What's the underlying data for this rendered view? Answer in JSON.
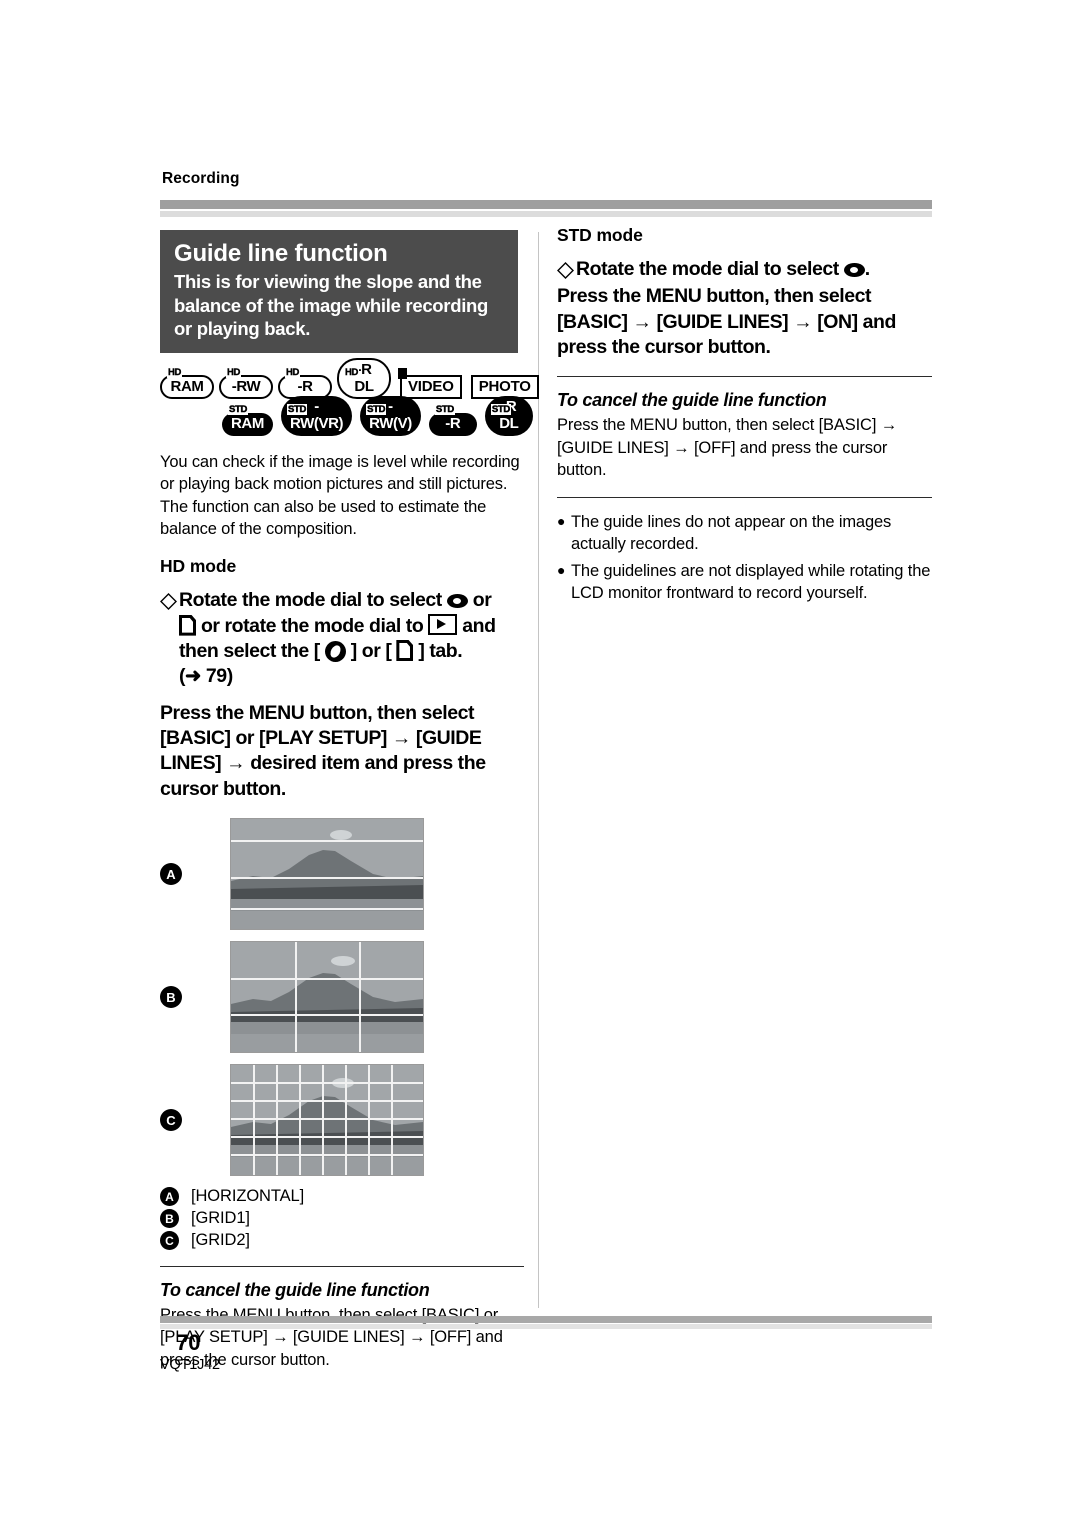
{
  "header": {
    "section_label": "Recording"
  },
  "title_box": {
    "heading": "Guide line function",
    "description": "This is for viewing the slope and the balance of the image while recording or playing back."
  },
  "media_badges": {
    "row1": [
      {
        "tag": "HD",
        "label": "RAM",
        "style": "outline-pill"
      },
      {
        "tag": "HD",
        "label": "-RW",
        "style": "outline-pill"
      },
      {
        "tag": "HD",
        "label": "-R",
        "style": "outline-pill"
      },
      {
        "tag": "HD",
        "label": "-R DL",
        "style": "outline-pill"
      },
      {
        "tag": "",
        "label": "VIDEO",
        "style": "rect-corner"
      },
      {
        "tag": "",
        "label": "PHOTO",
        "style": "rect"
      }
    ],
    "row2": [
      {
        "tag": "STD",
        "label": "RAM",
        "style": "filled-pill"
      },
      {
        "tag": "STD",
        "label": "-RW(VR)",
        "style": "filled-pill"
      },
      {
        "tag": "STD",
        "label": "-RW(V)",
        "style": "filled-pill"
      },
      {
        "tag": "STD",
        "label": "-R",
        "style": "filled-pill"
      },
      {
        "tag": "STD",
        "label": "-R DL",
        "style": "filled-pill"
      }
    ]
  },
  "left": {
    "intro": "You can check if the image is level while recording or playing back motion pictures and still pictures. The function can also be used to estimate the balance of the composition.",
    "hd_mode_heading": "HD mode",
    "hd_step1": {
      "part1": "Rotate the mode dial to select",
      "icon1": "video-mode-icon",
      "part2": "or",
      "icon2": "photo-mode-icon",
      "part3": "or rotate the mode dial to",
      "icon3": "playback-mode-icon",
      "part4": "and then select the [",
      "icon4": "video-tab-icon",
      "part5": "] or [",
      "icon5": "photo-tab-icon",
      "part6": "] tab.",
      "reference": "(➜ 79)"
    },
    "hd_step2": "Press the MENU button, then select [BASIC] or [PLAY SETUP] → [GUIDE LINES] → desired item and press the cursor button.",
    "samples": [
      {
        "marker": "A",
        "pattern": "horizontal",
        "label": "[HORIZONTAL]"
      },
      {
        "marker": "B",
        "pattern": "grid1",
        "label": "[GRID1]"
      },
      {
        "marker": "C",
        "pattern": "grid2",
        "label": "[GRID2]"
      }
    ],
    "cancel_heading": "To cancel the guide line function",
    "cancel_body": "Press the MENU button, then select [BASIC] or [PLAY SETUP] → [GUIDE LINES] → [OFF] and press the cursor button."
  },
  "right": {
    "std_mode_heading": "STD mode",
    "std_step1": {
      "part1": "Rotate the mode dial to select",
      "icon1": "video-mode-icon",
      "part2": "."
    },
    "std_step2": "Press the MENU button, then select [BASIC] → [GUIDE LINES] → [ON] and press the cursor button.",
    "cancel_heading": "To cancel the guide line function",
    "cancel_body": "Press the MENU button, then select [BASIC] → [GUIDE LINES] → [OFF] and press the cursor button.",
    "notes": [
      "The guide lines do not appear on the images actually recorded.",
      "The guidelines are not displayed while rotating the LCD monitor frontward to record yourself."
    ]
  },
  "footer": {
    "page_number": "70",
    "doc_code": "VQT1J42"
  },
  "colors": {
    "title_box_bg": "#4c4c4c",
    "rule_gray": "#9f9f9f",
    "rule_light": "#dcdcdc",
    "guide_line": "#f2f2f2"
  }
}
